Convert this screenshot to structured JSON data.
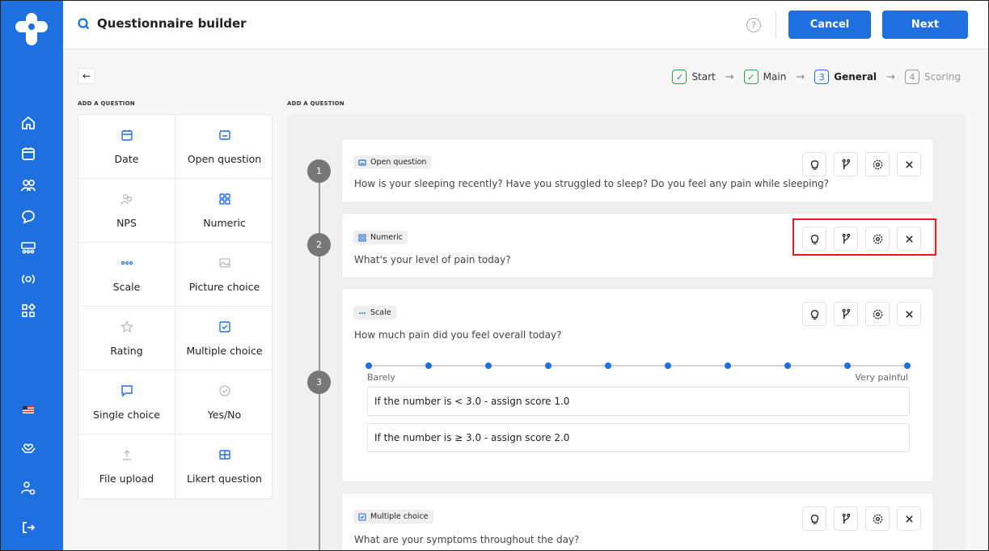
{
  "header": {
    "title": "Questionnaire builder",
    "help_glyph": "?",
    "cancel_label": "Cancel",
    "next_label": "Next"
  },
  "colors": {
    "brand": "#1e6fe0",
    "highlight": "#e41d1d",
    "done": "#2ea043"
  },
  "back_glyph": "←",
  "steps": [
    {
      "marker": "✓",
      "label": "Start",
      "state": "done"
    },
    {
      "marker": "✓",
      "label": "Main",
      "state": "done"
    },
    {
      "marker": "3",
      "label": "General",
      "state": "active"
    },
    {
      "marker": "4",
      "label": "Scoring",
      "state": "inactive"
    }
  ],
  "step_arrow": "→",
  "palette_label": "ADD A QUESTION",
  "canvas_label": "ADD A QUESTION",
  "palette": [
    {
      "label": "Date",
      "icon": "calendar-icon"
    },
    {
      "label": "Open question",
      "icon": "text-box-icon"
    },
    {
      "label": "NPS",
      "icon": "people-icon"
    },
    {
      "label": "Numeric",
      "icon": "grid-icon"
    },
    {
      "label": "Scale",
      "icon": "dots-icon"
    },
    {
      "label": "Picture choice",
      "icon": "image-icon"
    },
    {
      "label": "Rating",
      "icon": "star-icon"
    },
    {
      "label": "Multiple choice",
      "icon": "checkbox-icon"
    },
    {
      "label": "Single choice",
      "icon": "speech-bubble-icon"
    },
    {
      "label": "Yes/No",
      "icon": "check-circle-icon"
    },
    {
      "label": "File upload",
      "icon": "upload-icon"
    },
    {
      "label": "Likert question",
      "icon": "table-icon"
    }
  ],
  "questions": [
    {
      "number": "1",
      "type": "Open question",
      "text": "How is your sleeping recently? Have you struggled to sleep? Do you feel any pain while sleeping?"
    },
    {
      "number": "2",
      "type": "Numeric",
      "text": "What's your level of pain today?"
    },
    {
      "number": "3",
      "type": "Scale",
      "text": "How much pain did you feel overall today?",
      "scale_min_label": "Barely",
      "scale_max_label": "Very painful",
      "scale_points": 10,
      "rules": [
        "If the number is < 3.0 - assign score 1.0",
        "If the number is ≥ 3.0 - assign score 2.0"
      ]
    },
    {
      "number": "",
      "type": "Multiple choice",
      "text": "What are your symptoms throughout the day?"
    }
  ]
}
